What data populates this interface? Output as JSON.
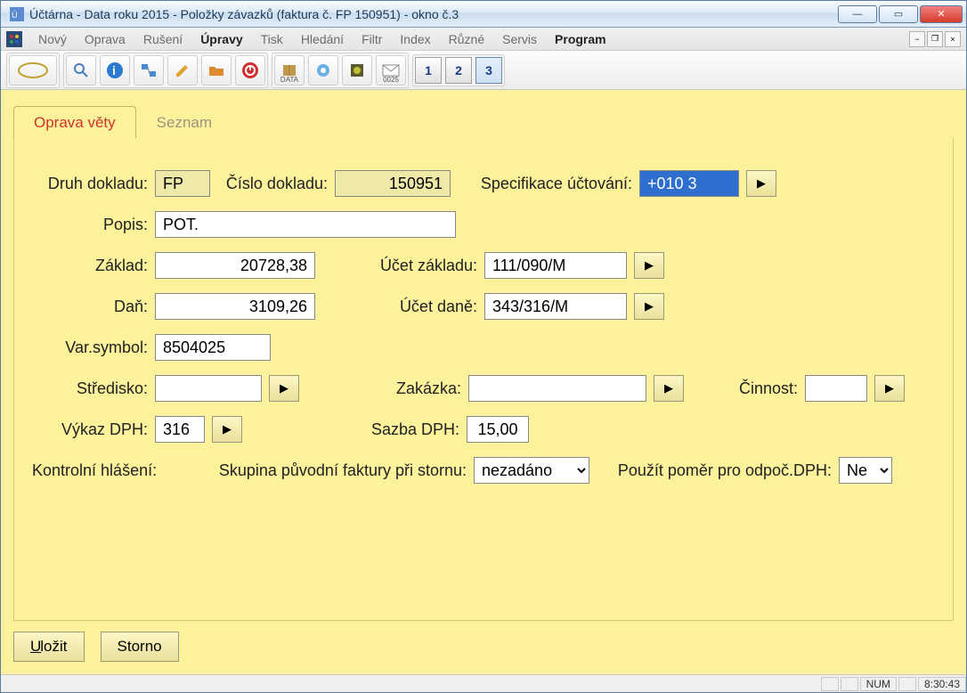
{
  "window": {
    "title": "Účtárna - Data roku 2015 - Položky závazků (faktura č. FP   150951) - okno č.3"
  },
  "menu": {
    "items": [
      "Nový",
      "Oprava",
      "Rušení",
      "Úpravy",
      "Tisk",
      "Hledání",
      "Filtr",
      "Index",
      "Různé",
      "Servis",
      "Program"
    ],
    "emph_idx": [
      3,
      10
    ]
  },
  "toolbar": {
    "data_label": "DATA",
    "mail_label": "0025",
    "numbers": [
      "1",
      "2",
      "3"
    ],
    "active_num_idx": 2
  },
  "tabs": {
    "active": "Oprava věty",
    "inactive": "Seznam"
  },
  "form": {
    "labels": {
      "druh_dokladu": "Druh dokladu:",
      "cislo_dokladu": "Číslo dokladu:",
      "specifikace": "Specifikace účtování:",
      "popis": "Popis:",
      "zaklad": "Základ:",
      "ucet_zakladu": "Účet základu:",
      "dan": "Daň:",
      "ucet_dane": "Účet daně:",
      "var_symbol": "Var.symbol:",
      "stredisko": "Středisko:",
      "zakazka": "Zakázka:",
      "cinnost": "Činnost:",
      "vykaz_dph": "Výkaz DPH:",
      "sazba_dph": "Sazba DPH:",
      "kontrolni_hlaseni": "Kontrolní hlášení:",
      "skupina_storno": "Skupina původní faktury při stornu:",
      "pouzit_pomer": "Použít poměr pro odpoč.DPH:"
    },
    "values": {
      "druh_dokladu": "FP",
      "cislo_dokladu": "150951",
      "specifikace": "+010 3",
      "popis": "POT.",
      "zaklad": "20728,38",
      "ucet_zakladu": "111/090/M",
      "dan": "3109,26",
      "ucet_dane": "343/316/M",
      "var_symbol": "8504025",
      "stredisko": "",
      "zakazka": "",
      "cinnost": "",
      "vykaz_dph": "316",
      "sazba_dph": "15,00",
      "skupina_storno": "nezadáno",
      "pouzit_pomer": "Ne"
    }
  },
  "buttons": {
    "save": "Uložit",
    "cancel": "Storno"
  },
  "status": {
    "num": "NUM",
    "time": "8:30:43"
  }
}
